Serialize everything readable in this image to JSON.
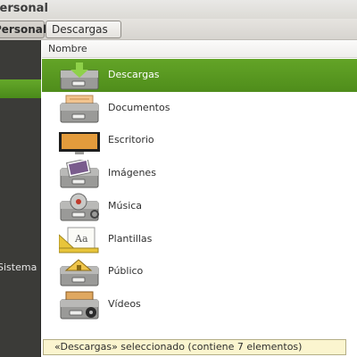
{
  "window": {
    "title": "Personal"
  },
  "breadcrumbs": [
    {
      "label": "Personal"
    },
    {
      "label": "Descargas"
    }
  ],
  "sidebar": {
    "items": [
      {
        "label": "Sistema"
      }
    ]
  },
  "list": {
    "column_header": "Nombre",
    "items": [
      {
        "label": "Descargas",
        "icon": "download-folder-icon",
        "selected": true
      },
      {
        "label": "Documentos",
        "icon": "documents-folder-icon"
      },
      {
        "label": "Escritorio",
        "icon": "desktop-folder-icon"
      },
      {
        "label": "Imágenes",
        "icon": "pictures-folder-icon"
      },
      {
        "label": "Música",
        "icon": "music-folder-icon"
      },
      {
        "label": "Plantillas",
        "icon": "templates-folder-icon"
      },
      {
        "label": "Público",
        "icon": "public-folder-icon"
      },
      {
        "label": "Vídeos",
        "icon": "videos-folder-icon"
      }
    ]
  },
  "status": {
    "text": "«Descargas» seleccionado  (contiene 7 elementos)"
  },
  "colors": {
    "accent": "#4f8d1b",
    "sidebar": "#3b3b38",
    "status_bg": "#fbf5cf"
  }
}
